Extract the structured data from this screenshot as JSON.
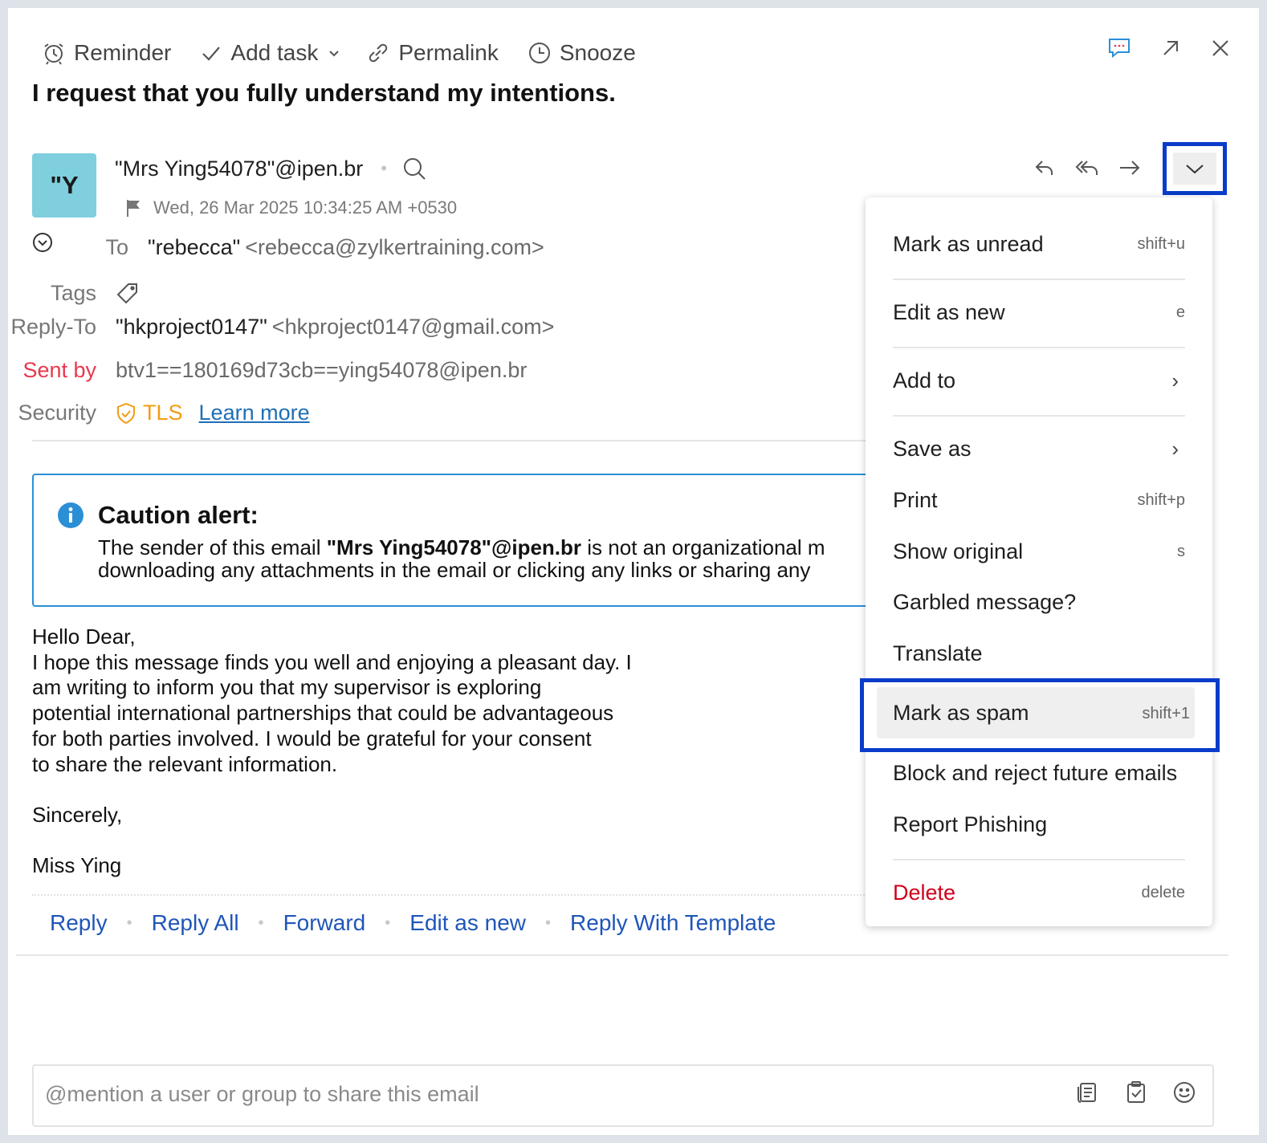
{
  "toolbar": {
    "reminder": "Reminder",
    "add_task": "Add task",
    "permalink": "Permalink",
    "snooze": "Snooze"
  },
  "subject": "I request that you fully understand my intentions.",
  "sender": {
    "avatar": "\"Y",
    "address": "\"Mrs Ying54078\"@ipen.br",
    "dot": "•",
    "datetime": "Wed, 26 Mar 2025 10:34:25 AM +0530"
  },
  "header": {
    "to_label": "To",
    "to_name": "\"rebecca\"",
    "to_email": "<rebecca@zylkertraining.com>",
    "tags_label": "Tags",
    "replyto_label": "Reply-To",
    "replyto_name": "\"hkproject0147\"",
    "replyto_email": "<hkproject0147@gmail.com>",
    "sentby_label": "Sent by",
    "sentby_value": "btv1==180169d73cb==ying54078@ipen.br",
    "security_label": "Security",
    "security_value": "TLS",
    "learn_more": "Learn more"
  },
  "caution": {
    "title": "Caution alert:",
    "line1_pre": "The sender of this email ",
    "line1_bold": "\"Mrs Ying54078\"@ipen.br",
    "line1_post": " is not an organizational m",
    "line2": "downloading any attachments in the email or clicking any links or sharing any"
  },
  "body": {
    "greeting": "Hello Dear,",
    "lines": [
      "I hope this message finds you well and enjoying a pleasant day. I",
      "am writing to inform you that my supervisor is exploring",
      "potential international partnerships that could be advantageous",
      "for both parties involved. I would be grateful for your consent",
      "to share the relevant information."
    ],
    "closing": "Sincerely,",
    "signature": "Miss Ying"
  },
  "reply_bar": {
    "reply": "Reply",
    "reply_all": "Reply All",
    "forward": "Forward",
    "edit_as_new": "Edit as new",
    "reply_template": "Reply With Template",
    "sep": "•"
  },
  "mention": {
    "placeholder": "@mention a user or group to share this email"
  },
  "menu": {
    "items": [
      {
        "label": "Mark as unread",
        "shortcut": "shift+u"
      },
      {
        "label": "Edit as new",
        "shortcut": "e"
      },
      {
        "label": "Add to",
        "shortcut": "›"
      },
      {
        "label": "Save as",
        "shortcut": "›"
      },
      {
        "label": "Print",
        "shortcut": "shift+p"
      },
      {
        "label": "Show original",
        "shortcut": "s"
      },
      {
        "label": "Garbled message?",
        "shortcut": ""
      },
      {
        "label": "Translate",
        "shortcut": ""
      },
      {
        "label": "Mark as spam",
        "shortcut": "shift+1"
      },
      {
        "label": "Block and reject future emails",
        "shortcut": ""
      },
      {
        "label": "Report Phishing",
        "shortcut": ""
      },
      {
        "label": "Delete",
        "shortcut": "delete"
      }
    ]
  },
  "colors": {
    "accent_link": "#1f56b8",
    "highlight_border": "#0a3cc9",
    "danger": "#d0021b",
    "sent_by_label": "#e8384f",
    "tls": "#f39c12",
    "avatar_bg": "#7fcfde",
    "info_blue": "#2b8fd6"
  }
}
